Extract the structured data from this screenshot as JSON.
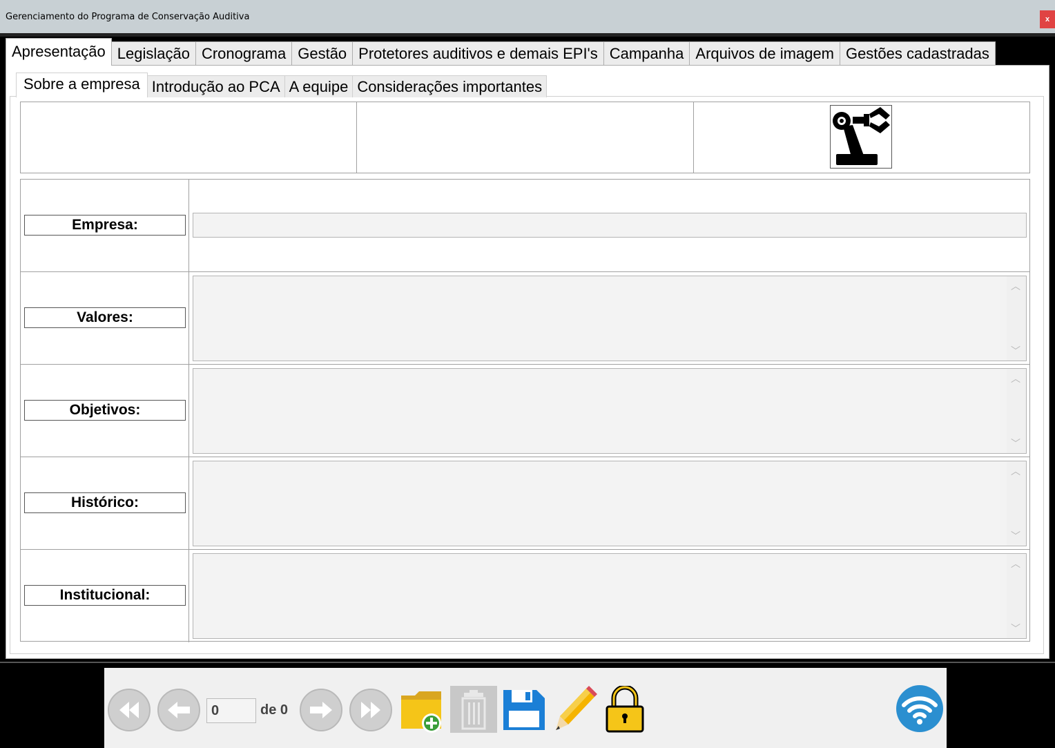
{
  "window": {
    "title": "Gerenciamento do Programa de Conservação Auditiva",
    "close_label": "x"
  },
  "main_tabs": [
    {
      "label": "Apresentação",
      "active": true
    },
    {
      "label": "Legislação"
    },
    {
      "label": "Cronograma"
    },
    {
      "label": "Gestão"
    },
    {
      "label": "Protetores auditivos e demais EPI's"
    },
    {
      "label": "Campanha"
    },
    {
      "label": "Arquivos de imagem"
    },
    {
      "label": "Gestões cadastradas"
    }
  ],
  "sub_tabs": [
    {
      "label": "Sobre a empresa",
      "active": true
    },
    {
      "label": "Introdução ao PCA"
    },
    {
      "label": "A equipe"
    },
    {
      "label": "Considerações importantes"
    }
  ],
  "form": {
    "empresa_label": "Empresa:",
    "empresa_value": "",
    "valores_label": "Valores:",
    "valores_value": "",
    "objetivos_label": "Objetivos:",
    "objetivos_value": "",
    "historico_label": "Histórico:",
    "historico_value": "",
    "institucional_label": "Institucional:",
    "institucional_value": ""
  },
  "navigator": {
    "current": "0",
    "of_label": "de 0"
  },
  "icons": {
    "robot": "robot-arm-icon",
    "first": "first-record-icon",
    "prev": "previous-record-icon",
    "next": "next-record-icon",
    "last": "last-record-icon",
    "new": "new-folder-icon",
    "delete": "trash-icon",
    "save": "save-icon",
    "edit": "pencil-icon",
    "lock": "lock-icon",
    "wifi": "wifi-icon"
  },
  "colors": {
    "disabled_nav": "#c9c9c9",
    "save_blue": "#1b7fd6",
    "lock_yellow": "#f5c518",
    "wifi_blue": "#2b8fd0"
  }
}
